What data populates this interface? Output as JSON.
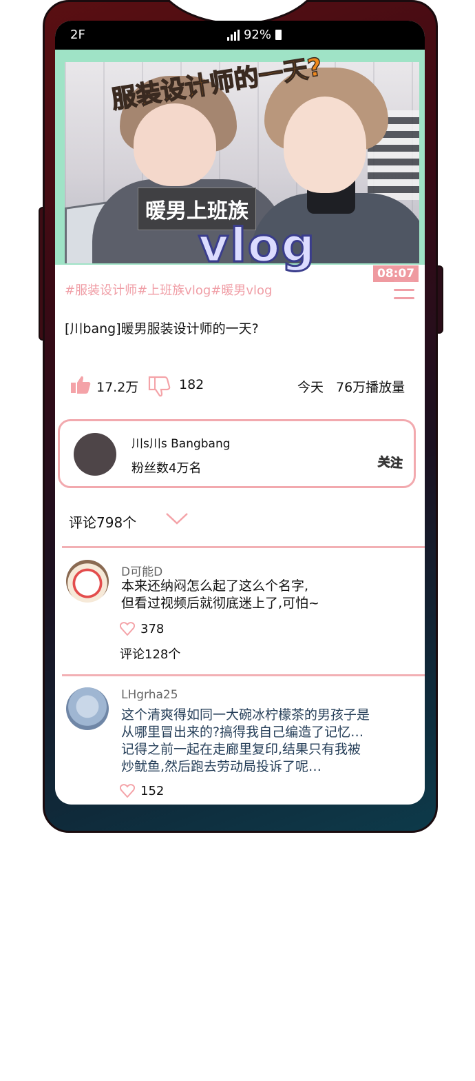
{
  "status_bar": {
    "carrier": "2F",
    "battery_percent": "92%"
  },
  "video": {
    "thumbnail_title": "服装设计师的一天?",
    "thumbnail_tag": "暖男上班族",
    "thumbnail_vlog": "vlog",
    "duration": "08:07",
    "hashtags": "#服装设计师#上班族vlog#暖男vlog",
    "title": "[川bang]暖男服装设计师的一天?",
    "likes": "17.2万",
    "dislikes": "182",
    "date": "今天",
    "views": "76万播放量"
  },
  "channel": {
    "name": "川s川s Bangbang",
    "subscribers": "粉丝数4万名",
    "follow_label": "关注"
  },
  "comments_header": "评论798个",
  "comments": [
    {
      "user": "D可能D",
      "text_lines": [
        "本来还纳闷怎么起了这么个名字,",
        "但看过视频后就彻底迷上了,可怕~"
      ],
      "likes": "378",
      "replies": "评论128个",
      "avatar": "cake-avatar"
    },
    {
      "user": "LHgrha25",
      "text_lines": [
        "这个清爽得如同一大碗冰柠檬茶的男孩子是",
        "从哪里冒出来的?搞得我自己编造了记忆…",
        "记得之前一起在走廊里复印,结果只有我被",
        "炒鱿鱼,然后跑去劳动局投诉了呢…"
      ],
      "likes": "152",
      "avatar": "face-avatar"
    }
  ],
  "colors": {
    "accent_pink": "#f09ea6",
    "thumb_border": "#9fe3c6",
    "phone_frame_top": "#5a0f12",
    "phone_frame_bottom": "#0d3a4a"
  }
}
